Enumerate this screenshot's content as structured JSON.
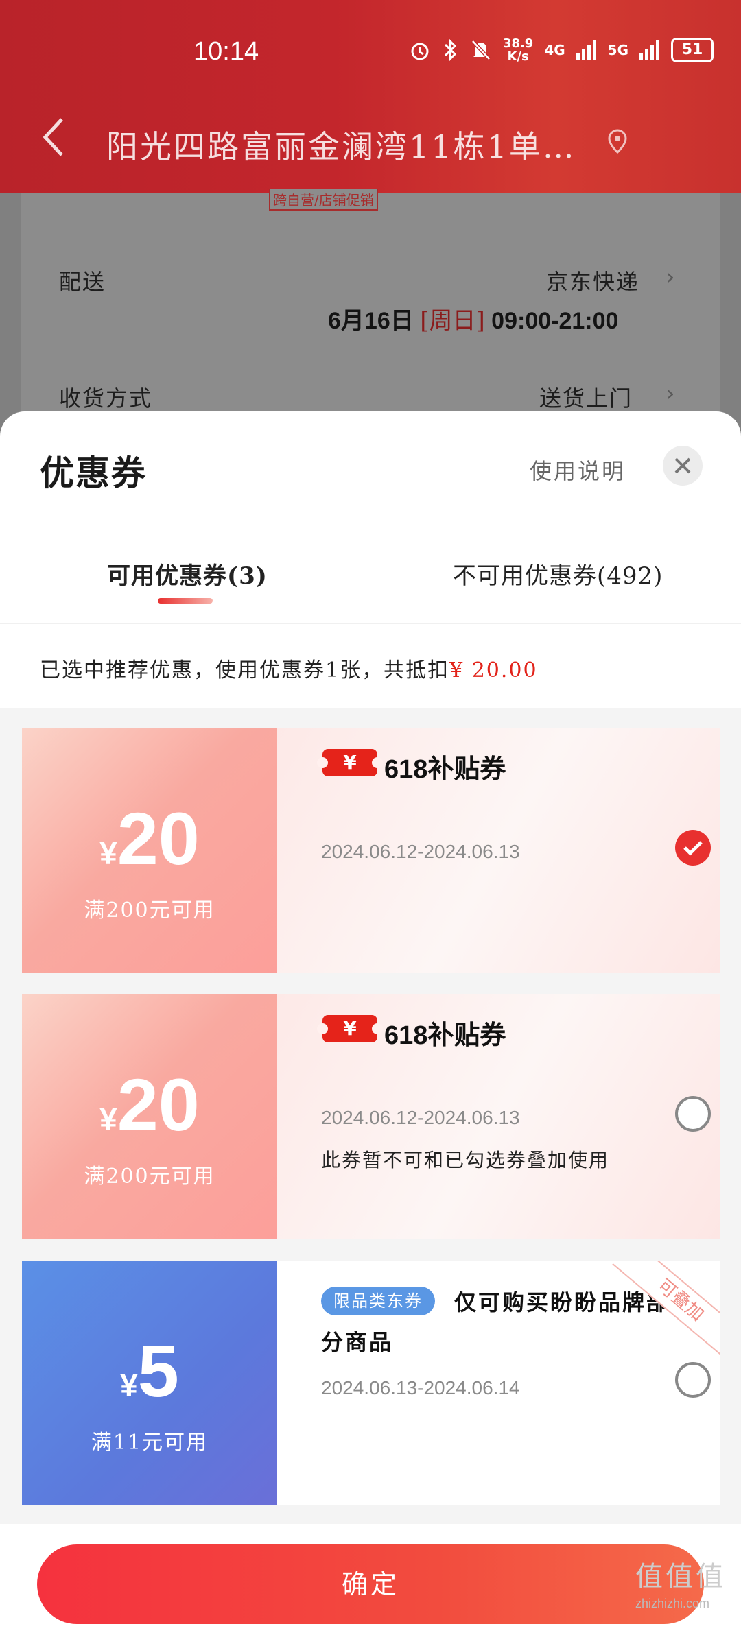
{
  "status_bar": {
    "time": "10:14",
    "net_speed": "38.9",
    "net_unit": "K/s",
    "signal1": "4G",
    "signal2": "5G",
    "battery": "51"
  },
  "header": {
    "title": "阳光四路富丽金澜湾11栋1单…"
  },
  "order": {
    "promo_tag": "跨自营/店铺促销",
    "delivery_label": "配送",
    "delivery_value": "京东快递",
    "delivery_date": "6月16日",
    "delivery_weekday": "[周日]",
    "delivery_window": "09:00-21:00",
    "receive_label": "收货方式",
    "receive_value": "送货上门"
  },
  "sheet": {
    "title": "优惠券",
    "usage_link": "使用说明",
    "tabs": [
      {
        "label": "可用优惠券(3)"
      },
      {
        "label": "不可用优惠券(492)"
      }
    ],
    "summary_text": "已选中推荐优惠，使用优惠券1张，共抵扣",
    "summary_amount": "¥ 20.00",
    "confirm_label": "确定"
  },
  "coupons": [
    {
      "currency": "¥",
      "amount": "20",
      "condition": "满200元可用",
      "badge": "¥",
      "name": "618补贴券",
      "date": "2024.06.12-2024.06.13",
      "note": "",
      "selected": true
    },
    {
      "currency": "¥",
      "amount": "20",
      "condition": "满200元可用",
      "badge": "¥",
      "name": "618补贴券",
      "date": "2024.06.12-2024.06.13",
      "note": "此券暂不可和已勾选券叠加使用",
      "selected": false
    },
    {
      "currency": "¥",
      "amount": "5",
      "condition": "满11元可用",
      "category": "限品类东券",
      "name": "仅可购买盼盼品牌部分商品",
      "date": "2024.06.13-2024.06.14",
      "ribbon": "可叠加",
      "selected": false
    }
  ],
  "watermark": {
    "logo": "值值值",
    "site": "zhizhizhi.com"
  },
  "colors": {
    "accent": "#e8302f",
    "header": "#c3262c",
    "blue_coupon": "#5b90e6"
  }
}
